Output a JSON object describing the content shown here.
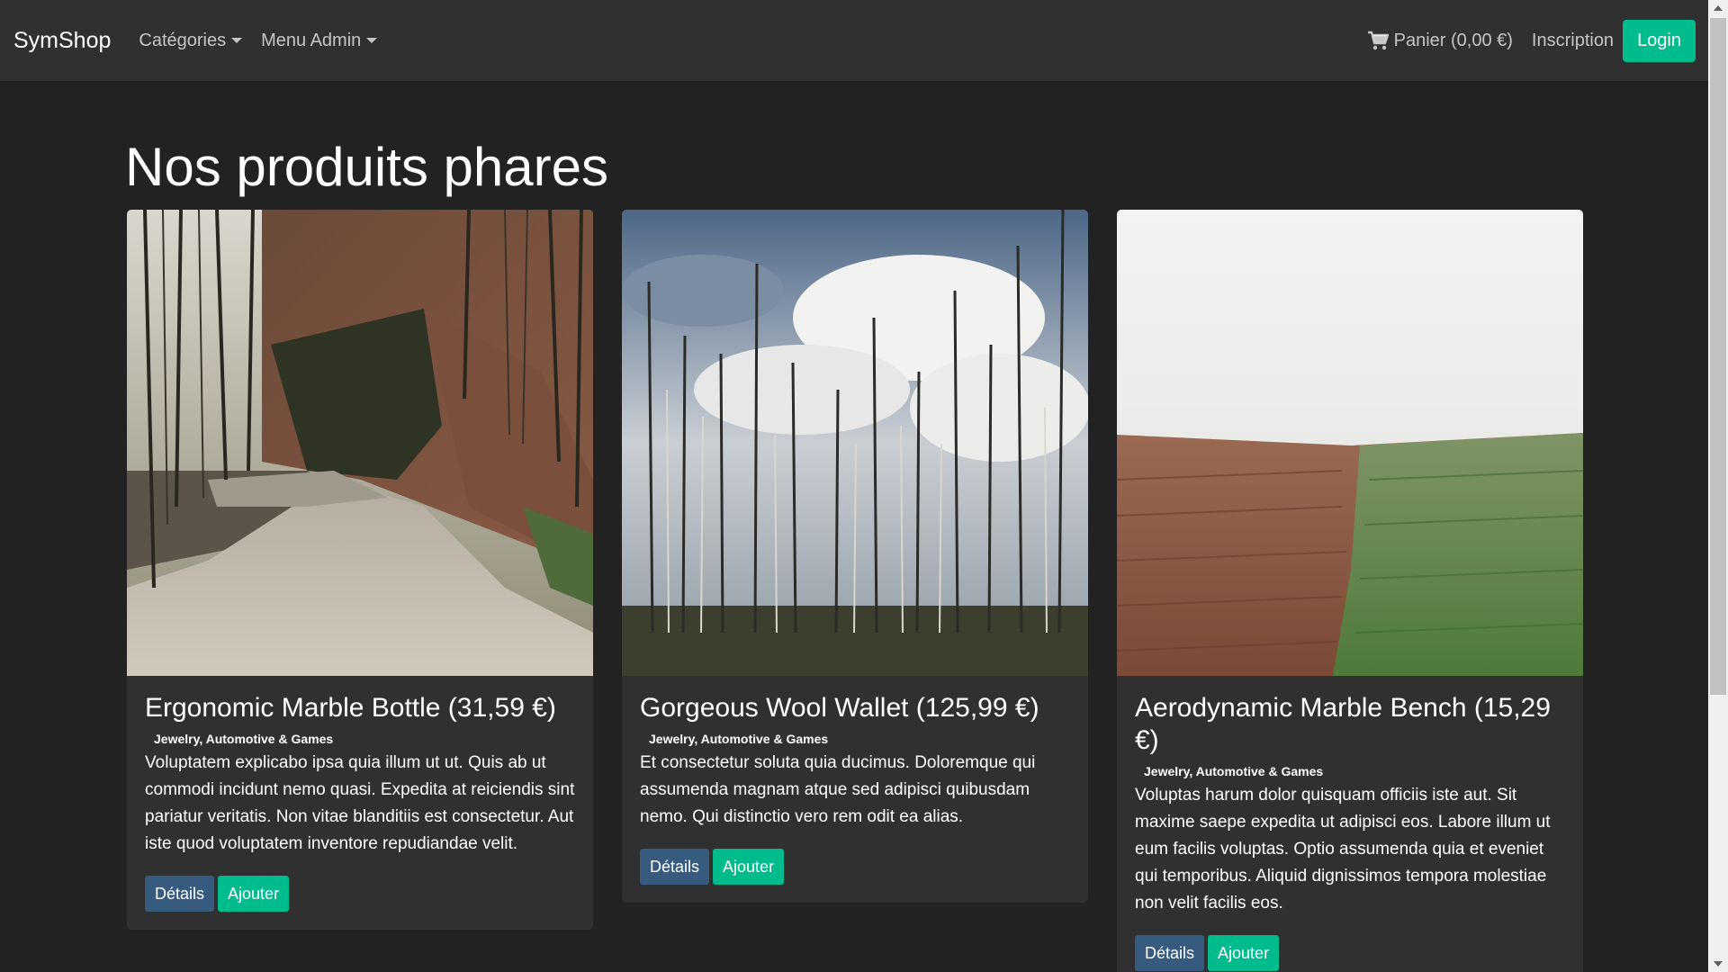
{
  "navbar": {
    "brand": "SymShop",
    "categories_label": "Catégories",
    "admin_menu_label": "Menu Admin",
    "cart_label": "Panier (0,00 €)",
    "signup_label": "Inscription",
    "login_label": "Login",
    "cart_icon": "shopping-cart-icon",
    "caret_icon": "caret-down-icon"
  },
  "main": {
    "title": "Nos produits phares"
  },
  "products": [
    {
      "title": "Ergonomic Marble Bottle (31,59 €)",
      "category": "Jewelry, Automotive & Games",
      "description": "Voluptatem explicabo ipsa quia illum ut ut. Quis ab ut commodi incidunt nemo quasi. Expedita at reiciendis sint pariatur veritatis. Non vitae blanditiis est consectetur. Aut iste quod voluptatem inventore repudiandae velit.",
      "details_label": "Détails",
      "add_label": "Ajouter"
    },
    {
      "title": "Gorgeous Wool Wallet (125,99 €)",
      "category": "Jewelry, Automotive & Games",
      "description": "Et consectetur soluta quia ducimus. Doloremque qui assumenda magnam atque sed adipisci quibusdam nemo. Qui distinctio vero rem odit ea alias.",
      "details_label": "Détails",
      "add_label": "Ajouter"
    },
    {
      "title": "Aerodynamic Marble Bench (15,29 €)",
      "category": "Jewelry, Automotive & Games",
      "description": "Voluptas harum dolor quisquam officiis iste aut. Sit maxime saepe expedita ut adipisci eos. Labore illum ut eum facilis voluptas. Optio assumenda quia et eveniet qui temporibus. Aliquid dignissimos tempora molestiae non velit facilis eos.",
      "details_label": "Détails",
      "add_label": "Ajouter"
    }
  ],
  "colors": {
    "background": "#222222",
    "navbar": "#303030",
    "accent": "#00bc8c",
    "primary": "#375a7f"
  }
}
